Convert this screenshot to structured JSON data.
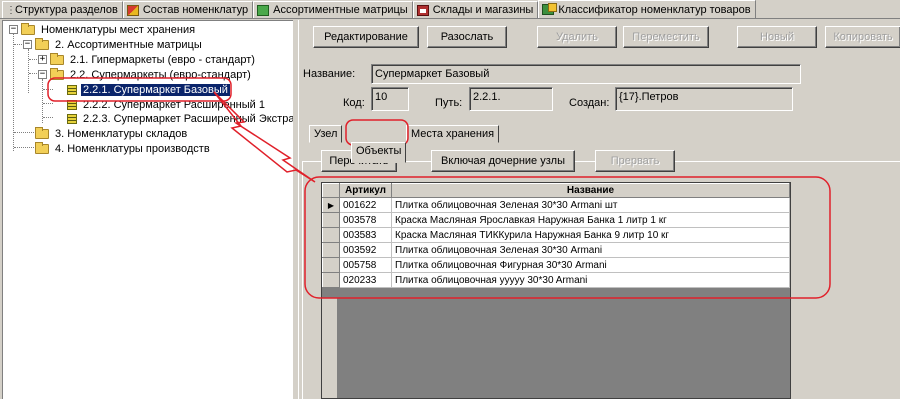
{
  "top_tabs": [
    {
      "label": "Структура разделов",
      "icon": "dots-icon"
    },
    {
      "label": "Состав номенклатур",
      "icon": "composition-icon"
    },
    {
      "label": "Ассортиментные матрицы",
      "icon": "matrix-icon"
    },
    {
      "label": "Склады и магазины",
      "icon": "warehouse-icon"
    },
    {
      "label": "Классификатор номенклатур товаров",
      "icon": "classifier-icon",
      "active": true
    }
  ],
  "tree": {
    "root": "Номенклатуры мест хранения",
    "n2": "2. Ассортиментные матрицы",
    "n21": "2.1. Гипермаркеты (евро - стандарт)",
    "n22": "2.2. Супермаркеты (евро-стандарт)",
    "n221": "2.2.1. Супермаркет Базовый",
    "n222": "2.2.2. Супермаркет Расширенный 1",
    "n223": "2.2.3. Супермаркет Расширенный Экстра",
    "n3": "3. Номенклатуры складов",
    "n4": "4. Номенклатуры производств"
  },
  "toolbar": {
    "edit": "Редактирование",
    "send": "Разослать",
    "delete": "Удалить",
    "move": "Переместить",
    "new": "Новый",
    "copy": "Копировать"
  },
  "form": {
    "name_label": "Название:",
    "name_value": "Супермаркет Базовый",
    "code_label": "Код:",
    "code_value": "10",
    "path_label": "Путь:",
    "path_value": "2.2.1.",
    "created_label": "Создан:",
    "created_value": "{17}.Петров"
  },
  "sub_tabs": {
    "node": "Узел",
    "objects": "Объекты",
    "storage": "Места хранения"
  },
  "actions": {
    "recount": "Перечитать",
    "include_children": "Включая дочерние узлы",
    "interrupt": "Прервать"
  },
  "grid": {
    "headers": {
      "article": "Артикул",
      "name": "Название"
    },
    "current_row_marker": "▶",
    "rows": [
      {
        "article": "001622",
        "name": "Плитка облицовочная Зеленая 30*30 Armani шт"
      },
      {
        "article": "003578",
        "name": "Краска Масляная Ярославкая Наружная Банка 1 литр 1 кг"
      },
      {
        "article": "003583",
        "name": "Краска Масляная ТИККурила Наружная Банка 9 литр 10 кг"
      },
      {
        "article": "003592",
        "name": "Плитка облицовочная Зеленая 30*30 Armani"
      },
      {
        "article": "005758",
        "name": "Плитка облицовочная Фигурная 30*30 Armani"
      },
      {
        "article": "020233",
        "name": "Плитка облицовочная уyyyy 30*30 Armani"
      }
    ]
  },
  "colors": {
    "annotation": "#e0202a",
    "selection": "#0a246a",
    "face": "#d4d0c8"
  }
}
